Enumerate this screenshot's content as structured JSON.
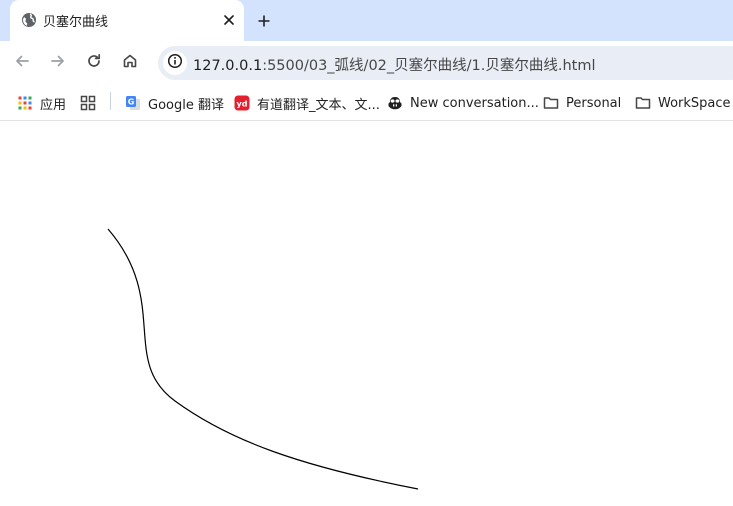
{
  "tab": {
    "title": "贝塞尔曲线",
    "favicon": "globe-icon"
  },
  "toolbar": {
    "url_host": "127.0.0.1",
    "url_path": ":5500/03_弧线/02_贝塞尔曲线/1.贝塞尔曲线.html"
  },
  "bookmarks": [
    {
      "label": "应用",
      "icon": "apps-grid-icon"
    },
    {
      "label": "",
      "icon": "tab-groups-icon"
    },
    {
      "label": "Google 翻译",
      "icon": "google-translate-icon"
    },
    {
      "label": "有道翻译_文本、文...",
      "icon": "youdao-icon"
    },
    {
      "label": "New conversation...",
      "icon": "copilot-icon"
    },
    {
      "label": "Personal",
      "icon": "folder-icon"
    },
    {
      "label": "WorkSpace",
      "icon": "folder-icon"
    }
  ],
  "colors": {
    "tabstrip_bg": "#d3e3fd",
    "omnibox_bg": "#e9eef6",
    "curve_stroke": "#000000"
  }
}
